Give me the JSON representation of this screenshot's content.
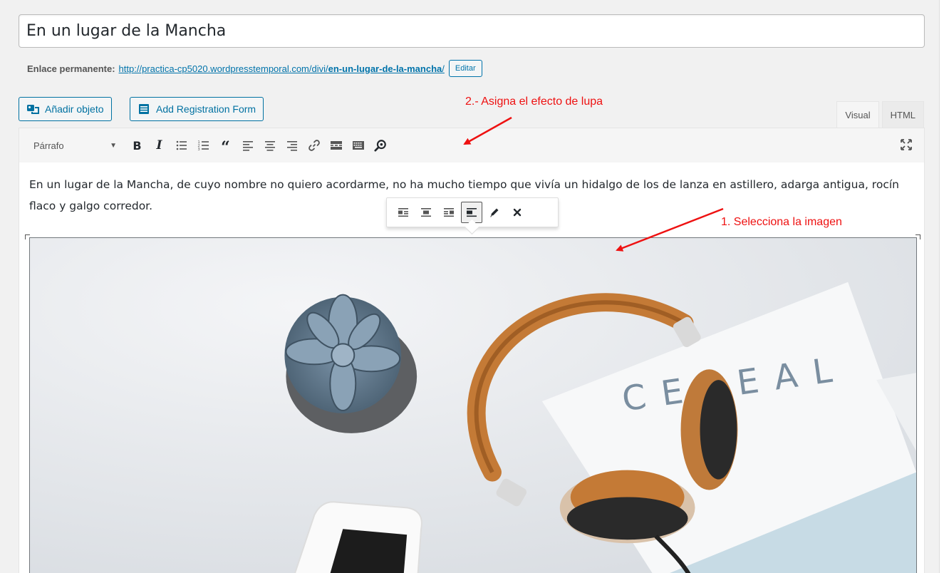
{
  "post": {
    "title": "En un lugar de la Mancha",
    "permalink_label": "Enlace permanente:",
    "permalink_base": "http://practica-cp5020.wordpresstemporal.com/divi/",
    "permalink_slug": "en-un-lugar-de-la-mancha",
    "permalink_trailing": "/",
    "edit_label": "Editar"
  },
  "media_buttons": {
    "add_media": "Añadir objeto",
    "add_registration": "Add Registration Form"
  },
  "editor_tabs": {
    "visual": "Visual",
    "html": "HTML",
    "active": "Visual"
  },
  "toolbar": {
    "format_select": "Párrafo",
    "buttons": [
      "bold",
      "italic",
      "bullet-list",
      "numbered-list",
      "blockquote",
      "align-left",
      "align-center",
      "align-right",
      "link",
      "read-more",
      "toolbar-toggle",
      "magnifier"
    ]
  },
  "content": {
    "paragraph": "En un lugar de la Mancha, de cuyo nombre no quiero acordarme, no ha mucho tiempo que vivía un hidalgo de los de lanza en astillero, adarga antigua, rocín flaco y galgo corredor.",
    "image_text": "CEREAL"
  },
  "image_toolbar": {
    "buttons": [
      "align-left",
      "align-center",
      "align-right",
      "align-none",
      "edit",
      "remove"
    ],
    "active": "align-none"
  },
  "annotations": {
    "step1": "1.  Selecciona la imagen",
    "step2": "2.- Asigna el efecto de lupa",
    "color": "#ee1111"
  }
}
